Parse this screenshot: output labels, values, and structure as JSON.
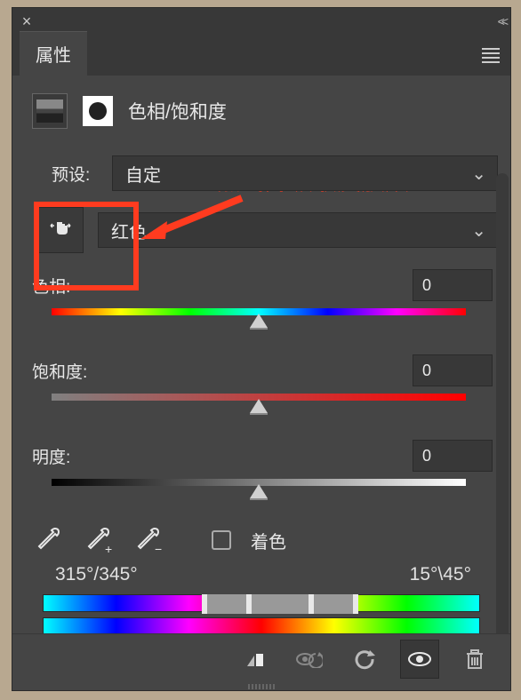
{
  "titlebar": {
    "close": "×",
    "collapse": "<<"
  },
  "tab": {
    "label": "属性"
  },
  "panel": {
    "title": "色相/饱和度"
  },
  "preset": {
    "label": "预设:",
    "value": "自定"
  },
  "channel": {
    "value": "红色"
  },
  "hue": {
    "label": "色相:",
    "value": "0"
  },
  "saturation": {
    "label": "饱和度:",
    "value": "0"
  },
  "lightness": {
    "label": "明度:",
    "value": "0"
  },
  "colorize": {
    "label": "着色"
  },
  "angles": {
    "left": "315°/345°",
    "right": "15°\\45°"
  },
  "annotation": {
    "text": "点击并吸取皮肤颜色"
  },
  "icons": {
    "finger": "targeted-adjustment",
    "dropper1": "eyedropper",
    "dropper2": "eyedropper-add",
    "dropper3": "eyedropper-subtract"
  }
}
